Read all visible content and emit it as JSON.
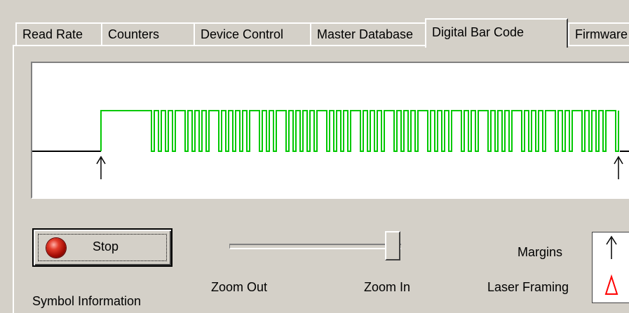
{
  "tabs": [
    {
      "label": "Read Rate"
    },
    {
      "label": "Counters"
    },
    {
      "label": "Device Control"
    },
    {
      "label": "Master Database"
    },
    {
      "label": "Digital Bar Code",
      "active": true
    },
    {
      "label": "Firmware"
    }
  ],
  "stop_button": {
    "label": "Stop",
    "indicator_color": "#c81e10"
  },
  "zoom": {
    "out_label": "Zoom Out",
    "in_label": "Zoom In",
    "level": 0.92
  },
  "legend": {
    "margins_label": "Margins",
    "laser_framing_label": "Laser Framing",
    "margin_marker_color": "#000000",
    "laser_marker_color": "#ff0000"
  },
  "symbol_information_label": "Symbol Information",
  "waveform": {
    "signal_color": "#00c800",
    "baseline_color": "#000000"
  }
}
